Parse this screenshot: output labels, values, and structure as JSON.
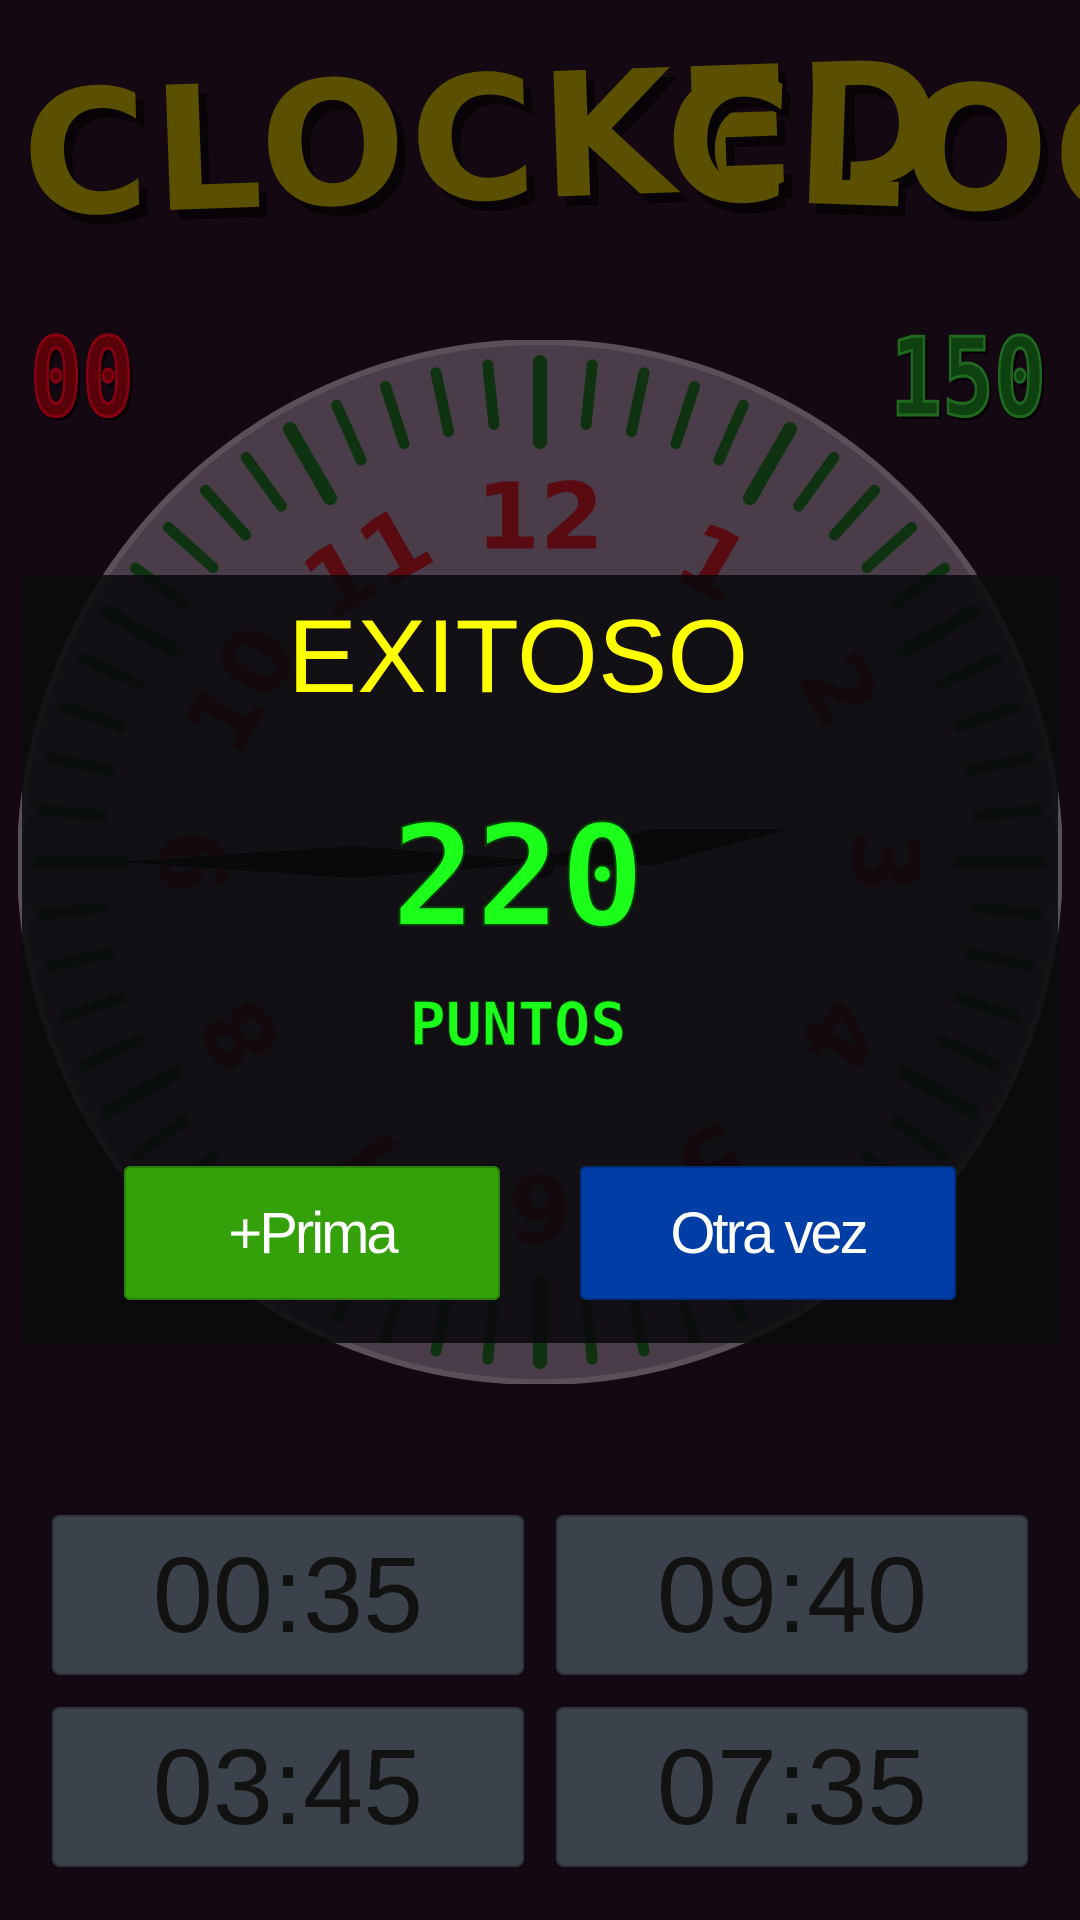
{
  "game": {
    "title_part1": "CLOCKED",
    "title_part2": "CLOCK",
    "score_left": "00",
    "score_right": "150"
  },
  "clock": {
    "numerals": [
      "12",
      "1",
      "2",
      "3",
      "4",
      "5",
      "6",
      "7",
      "8",
      "9",
      "10",
      "11"
    ],
    "hour_hand_value": 2.75,
    "minute_hand_value": 45,
    "colors": {
      "face": "#4b3c4a",
      "tick": "#0f3311",
      "numeral": "#5a0b12",
      "hand": "#000000"
    }
  },
  "result": {
    "title": "EXITOSO",
    "points_value": "220",
    "points_label": "PUNTOS",
    "bonus_button": "+Prima",
    "retry_button": "Otra vez",
    "colors": {
      "title": "#ffff00",
      "points": "#1bff1b",
      "bonus_button": "#34a00a",
      "retry_button": "#003da4"
    }
  },
  "answers": [
    "00:35",
    "09:40",
    "03:45",
    "07:35"
  ]
}
